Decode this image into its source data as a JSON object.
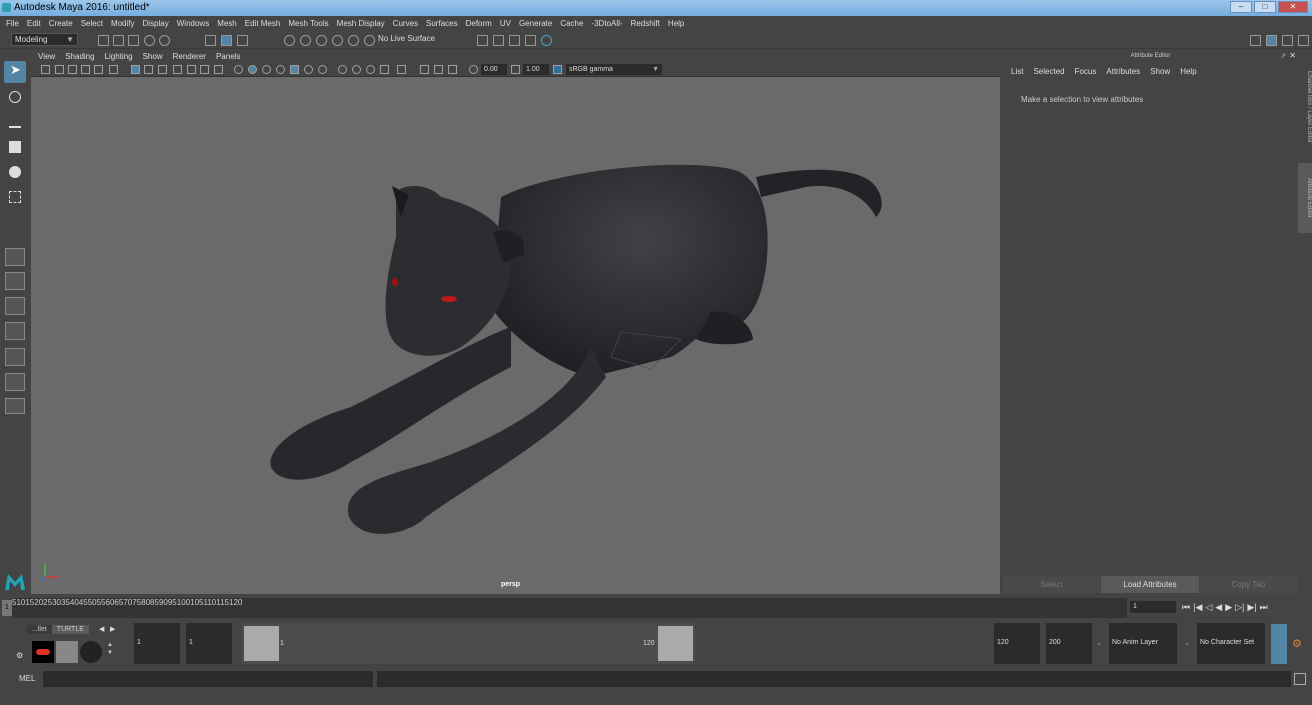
{
  "title": "Autodesk Maya 2016: untitled*",
  "menus": [
    "File",
    "Edit",
    "Create",
    "Select",
    "Modify",
    "Display",
    "Windows",
    "Mesh",
    "Edit Mesh",
    "Mesh Tools",
    "Mesh Display",
    "Curves",
    "Surfaces",
    "Deform",
    "UV",
    "Generate",
    "Cache",
    "-3DtoAll-",
    "Redshift",
    "Help"
  ],
  "mode": "Modeling",
  "live_surface": "No Live Surface",
  "panel_menus": [
    "View",
    "Shading",
    "Lighting",
    "Show",
    "Renderer",
    "Panels"
  ],
  "panel": {
    "val1": "0.00",
    "val2": "1.00",
    "gamma": "sRGB gamma"
  },
  "viewport_label": "persp",
  "attr": {
    "title": "Attribute Editor",
    "menus": [
      "List",
      "Selected",
      "Focus",
      "Attributes",
      "Show",
      "Help"
    ],
    "message": "Make a selection to view attributes",
    "buttons": [
      "Select",
      "Load Attributes",
      "Copy Tab"
    ]
  },
  "side_tabs": [
    "Channel Box / Layer Editor",
    "Attribute Editor"
  ],
  "timeline": {
    "ticks": [
      "5",
      "10",
      "15",
      "20",
      "25",
      "30",
      "35",
      "40",
      "45",
      "50",
      "55",
      "60",
      "65",
      "70",
      "75",
      "80",
      "85",
      "90",
      "95",
      "100",
      "105",
      "110",
      "115",
      "120"
    ],
    "current": "1",
    "frame_field": "1"
  },
  "shelf_tabs": [
    "...llet",
    "TURTLE"
  ],
  "range": {
    "start": "1",
    "start2": "1",
    "slider_start": "1",
    "slider_end": "120",
    "end": "120",
    "end2": "200",
    "anim_layer": "No Anim Layer",
    "char_set": "No Character Set"
  },
  "cmd": {
    "label": "MEL"
  }
}
